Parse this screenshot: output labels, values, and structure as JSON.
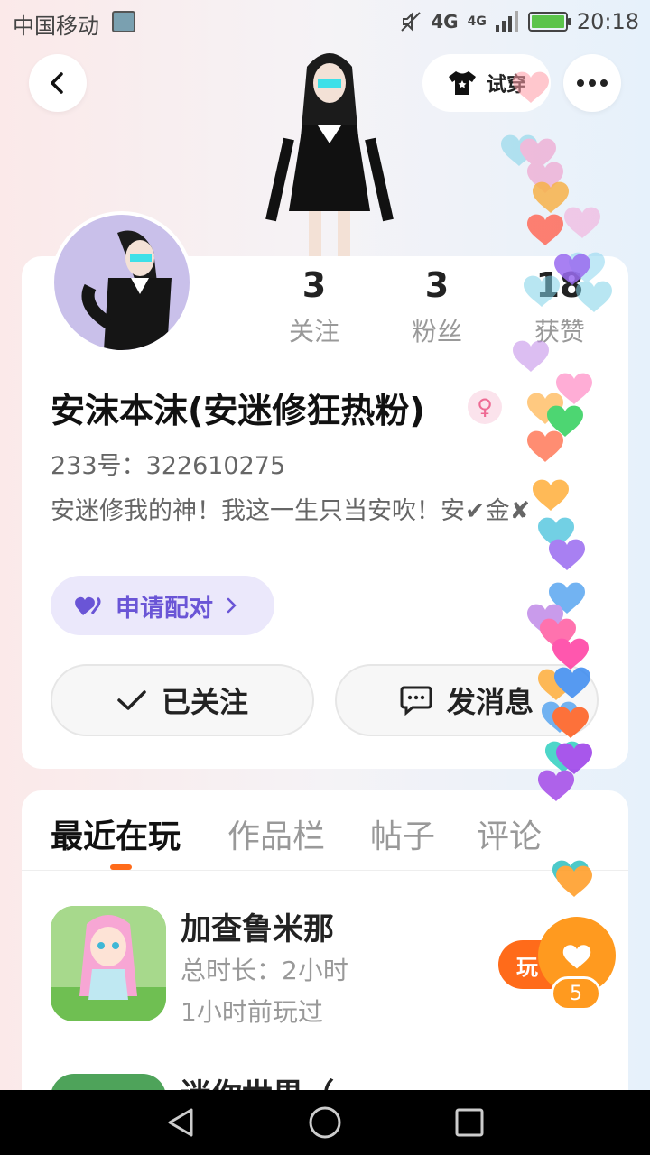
{
  "status_bar": {
    "carrier": "中国移动",
    "network_1": "4G",
    "network_2": "4G",
    "time": "20:18"
  },
  "header": {
    "back_icon": "chevron-left-icon",
    "tryon_label": "试穿",
    "more_icon": "more-dots-icon"
  },
  "profile": {
    "stats": [
      {
        "value": "3",
        "label": "关注"
      },
      {
        "value": "3",
        "label": "粉丝"
      },
      {
        "value": "18",
        "label": "获赞"
      }
    ],
    "name": "安沫本沫(安迷修狂热粉)",
    "gender_icon": "♀",
    "uid": "233号：322610275",
    "bio": "安迷修我的神！我这一生只当安吹！安✔金✘",
    "pair_label": "申请配对",
    "follow_label": "已关注",
    "message_label": "发消息"
  },
  "tabs": [
    "最近在玩",
    "作品栏",
    "帖子",
    "评论"
  ],
  "games": [
    {
      "title": "加查鲁米那",
      "duration": "总时长：2小时",
      "last_played": "1小时前玩过",
      "play_label": "玩"
    },
    {
      "title": "迷你世界（"
    }
  ],
  "like": {
    "count": "5"
  },
  "colors": {
    "accent_orange": "#ff6b1a",
    "like_orange": "#ff9a1f",
    "pair_purple": "#6a55d6",
    "gender_pink": "#ee6a93"
  }
}
